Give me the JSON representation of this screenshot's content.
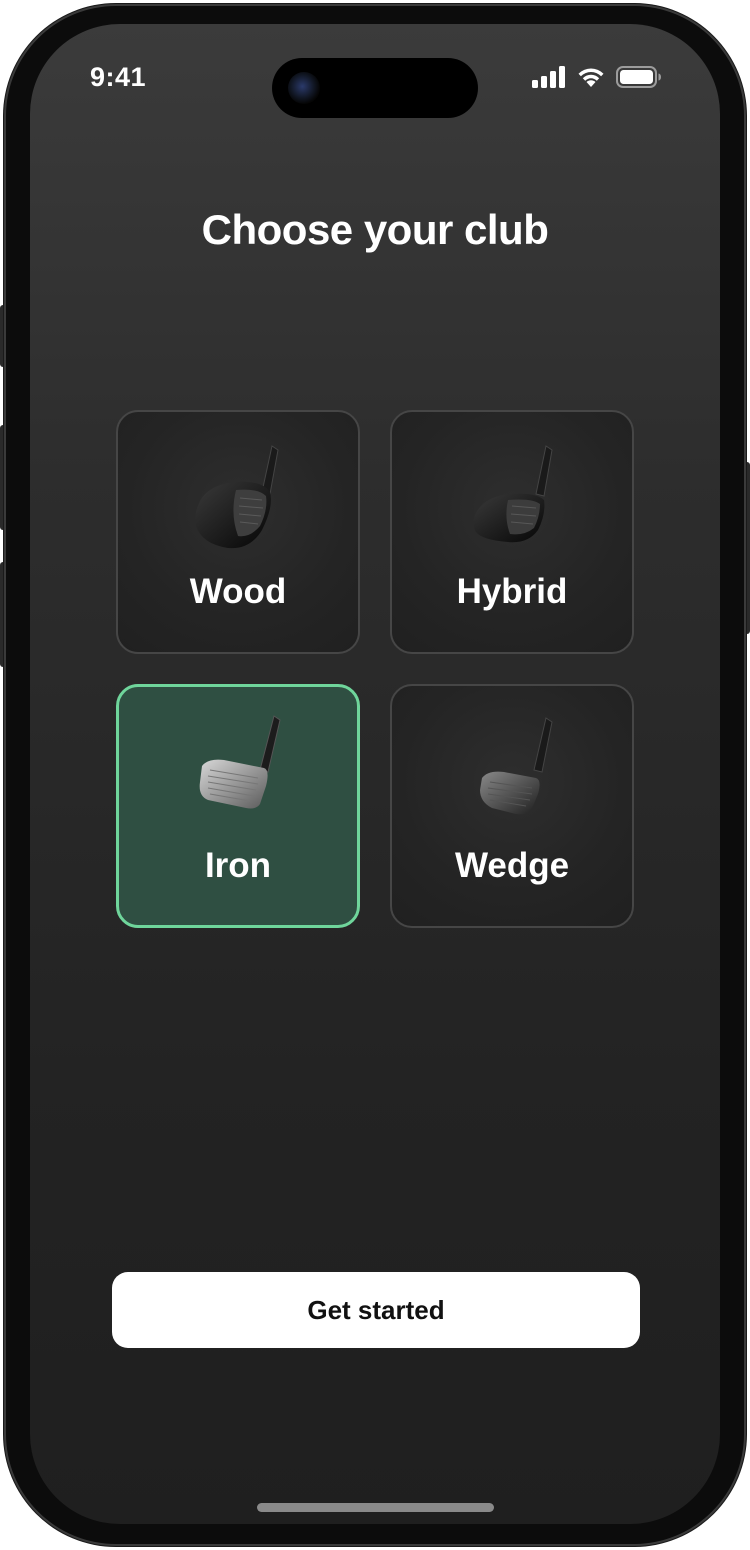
{
  "status_bar": {
    "time": "9:41"
  },
  "title": "Choose your club",
  "clubs": [
    {
      "label": "Wood",
      "icon": "wood-club-icon",
      "selected": false
    },
    {
      "label": "Hybrid",
      "icon": "hybrid-club-icon",
      "selected": false
    },
    {
      "label": "Iron",
      "icon": "iron-club-icon",
      "selected": true
    },
    {
      "label": "Wedge",
      "icon": "wedge-club-icon",
      "selected": false
    }
  ],
  "cta_label": "Get started",
  "colors": {
    "selected_fill": "#2f4f42",
    "selected_border": "#6fd59b",
    "card_fill": "#242424",
    "button_fill": "#ffffff"
  }
}
